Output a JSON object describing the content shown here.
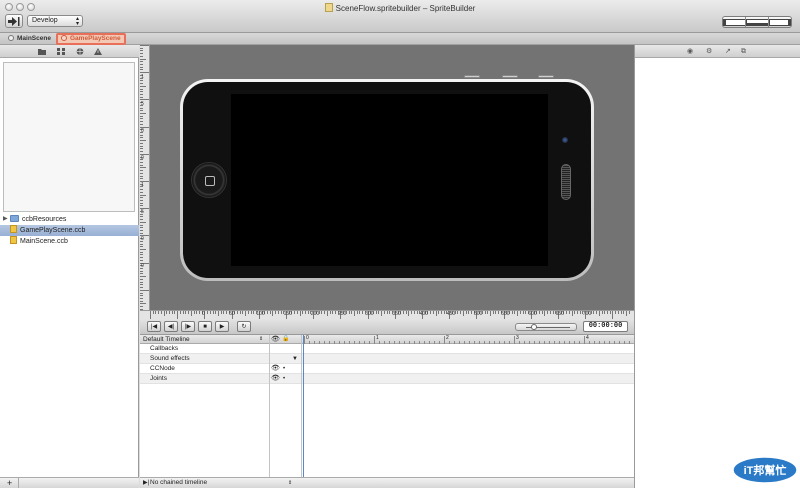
{
  "window": {
    "title": "SceneFlow.spritebuilder – SpriteBuilder"
  },
  "toolbar": {
    "scheme_popup": "Develop"
  },
  "tabs": [
    {
      "label": "MainScene",
      "active": false
    },
    {
      "label": "GamePlayScene",
      "active": true
    }
  ],
  "sidebar": {
    "files": [
      {
        "label": "ccbResources",
        "kind": "folder",
        "selected": false
      },
      {
        "label": "GamePlayScene.ccb",
        "kind": "ccb",
        "selected": true
      },
      {
        "label": "MainScene.ccb",
        "kind": "ccb",
        "selected": false
      }
    ],
    "add_label": "+"
  },
  "ruler": {
    "h_labels": [
      "0",
      "50",
      "100",
      "150",
      "200",
      "250",
      "300",
      "350",
      "400",
      "450",
      "500",
      "550",
      "600",
      "650",
      "700"
    ],
    "v_labels": [
      "1",
      "5",
      "0",
      "0",
      "1",
      "5",
      "0",
      "0"
    ]
  },
  "timeline": {
    "timecode": "00:00:00",
    "header": "Default Timeline",
    "rows": [
      {
        "label": "Callbacks"
      },
      {
        "label": "Sound effects"
      },
      {
        "label": "CCNode"
      },
      {
        "label": "Joints"
      }
    ],
    "ruler_marks": [
      "0",
      "1",
      "2",
      "3",
      "4"
    ],
    "footer": "No chained timeline"
  },
  "colors": {
    "active_tab": "#e8705a",
    "selection": "#a8bcdc",
    "canvas_bg": "#737373"
  },
  "watermark": {
    "text": "iT邦幫忙"
  }
}
